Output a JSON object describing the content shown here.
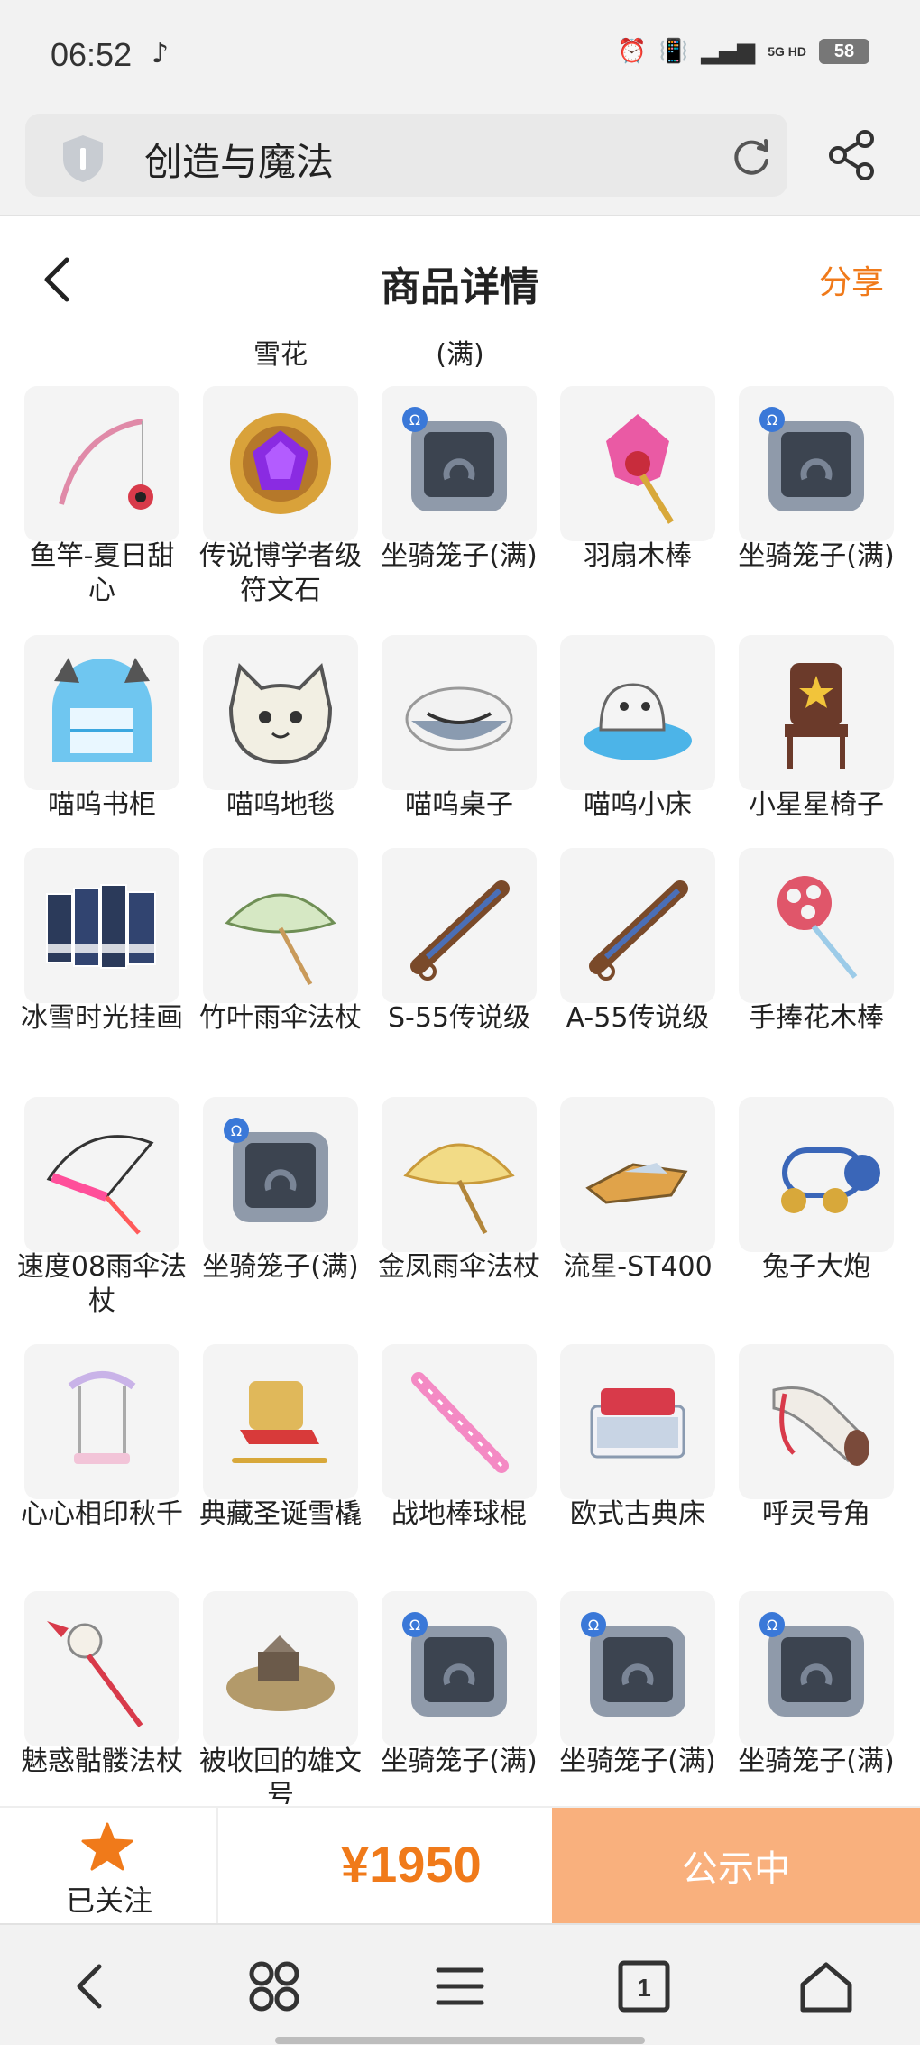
{
  "status_bar": {
    "time": "06:52",
    "battery": "58",
    "network": "5G HD"
  },
  "browser": {
    "address_text": "创造与魔法"
  },
  "header": {
    "title": "商品详情",
    "share_label": "分享"
  },
  "partial_row": [
    "雪花",
    "(满)"
  ],
  "items": [
    {
      "name": "鱼竿-夏日甜心",
      "icon": "fishing-rod-icon"
    },
    {
      "name": "传说博学者级符文石",
      "icon": "rune-stone-icon"
    },
    {
      "name": "坐骑笼子(满)",
      "icon": "mount-cage-icon"
    },
    {
      "name": "羽扇木棒",
      "icon": "feather-fan-staff-icon"
    },
    {
      "name": "坐骑笼子(满)",
      "icon": "mount-cage-icon"
    },
    {
      "name": "喵呜书柜",
      "icon": "cat-bookshelf-icon"
    },
    {
      "name": "喵呜地毯",
      "icon": "cat-rug-icon"
    },
    {
      "name": "喵呜桌子",
      "icon": "cat-table-icon"
    },
    {
      "name": "喵呜小床",
      "icon": "cat-bed-icon"
    },
    {
      "name": "小星星椅子",
      "icon": "star-chair-icon"
    },
    {
      "name": "冰雪时光挂画",
      "icon": "snow-painting-icon"
    },
    {
      "name": "竹叶雨伞法杖",
      "icon": "bamboo-umbrella-icon"
    },
    {
      "name": "S-55传说级",
      "icon": "gun-icon"
    },
    {
      "name": "A-55传说级",
      "icon": "gun-icon"
    },
    {
      "name": "手捧花木棒",
      "icon": "bouquet-staff-icon"
    },
    {
      "name": "速度08雨伞法杖",
      "icon": "racing-umbrella-icon"
    },
    {
      "name": "坐骑笼子(满)",
      "icon": "mount-cage-icon"
    },
    {
      "name": "金凤雨伞法杖",
      "icon": "golden-umbrella-icon"
    },
    {
      "name": "流星-ST400",
      "icon": "hover-vehicle-icon"
    },
    {
      "name": "兔子大炮",
      "icon": "rabbit-cannon-icon"
    },
    {
      "name": "心心相印秋千",
      "icon": "heart-swing-icon"
    },
    {
      "name": "典藏圣诞雪橇",
      "icon": "christmas-sleigh-icon"
    },
    {
      "name": "战地棒球棍",
      "icon": "baseball-bat-icon"
    },
    {
      "name": "欧式古典床",
      "icon": "classic-bed-icon"
    },
    {
      "name": "呼灵号角",
      "icon": "horn-icon"
    },
    {
      "name": "魅惑骷髅法杖",
      "icon": "skull-staff-icon"
    },
    {
      "name": "被收回的雄文号",
      "icon": "wrecked-ship-icon"
    },
    {
      "name": "坐骑笼子(满)",
      "icon": "mount-cage-icon"
    },
    {
      "name": "坐骑笼子(满)",
      "icon": "mount-cage-icon"
    },
    {
      "name": "坐骑笼子(满)",
      "icon": "mount-cage-icon"
    }
  ],
  "purchase_bar": {
    "follow_label": "已关注",
    "price": "¥1950",
    "status_button": "公示中"
  },
  "colors": {
    "accent": "#f07a1a",
    "button_bg": "#f9b07d"
  },
  "bottom_nav": [
    "back-icon",
    "apps-icon",
    "menu-icon",
    "tabs-icon",
    "home-icon"
  ],
  "bottom_nav_tab_count": "1"
}
